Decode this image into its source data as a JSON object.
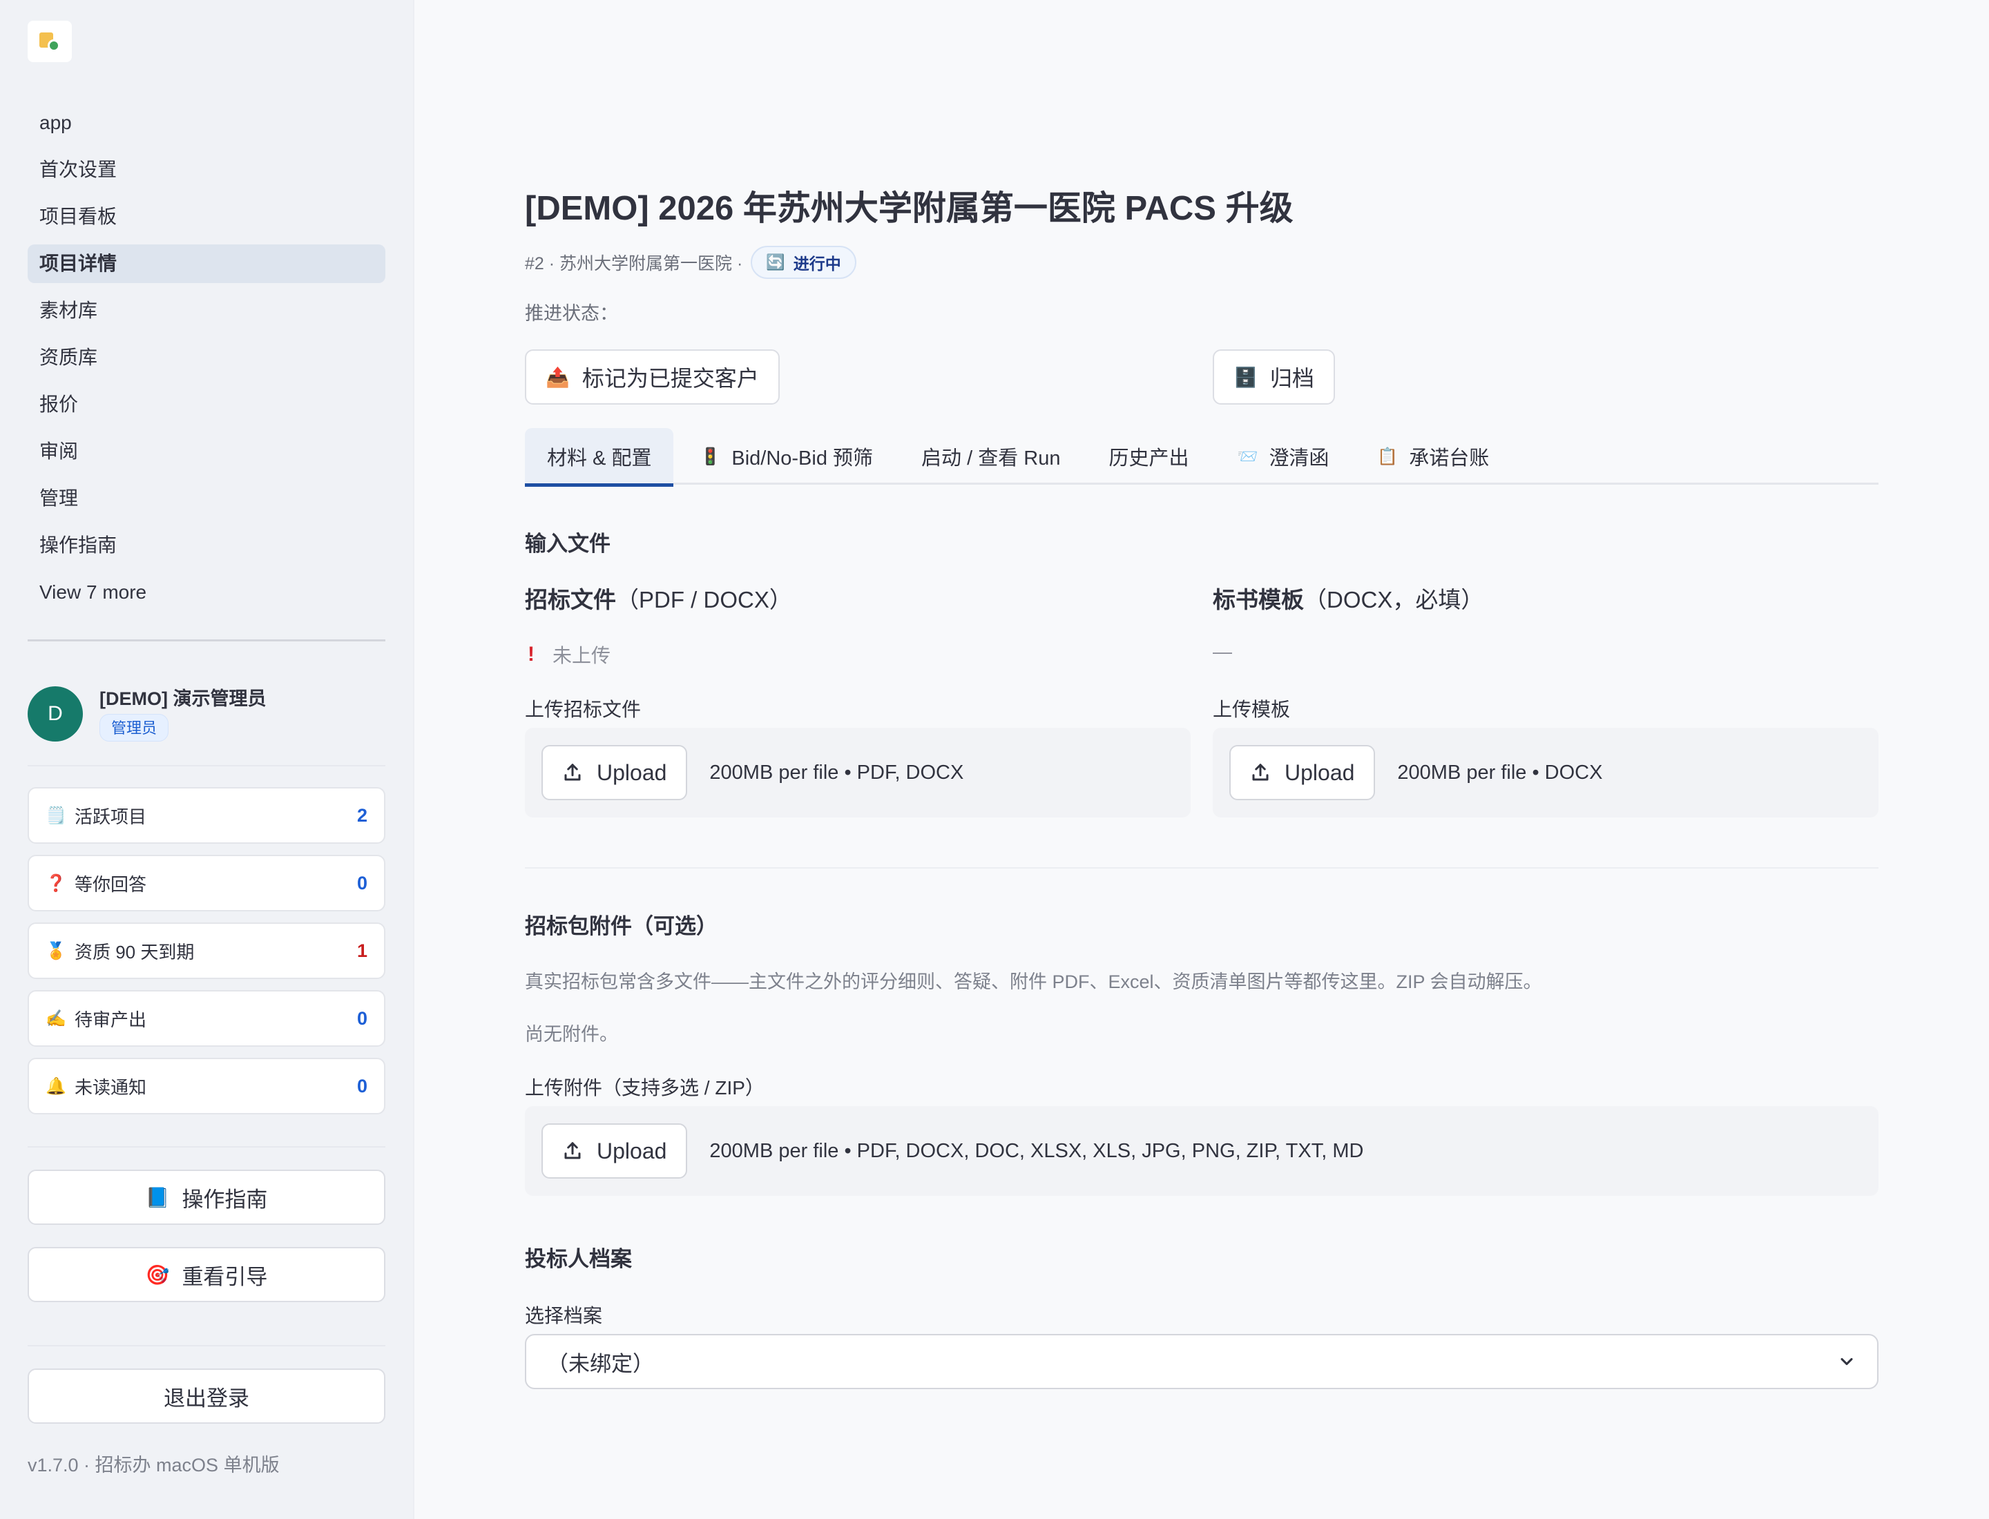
{
  "sidebar": {
    "nav": [
      {
        "label": "app"
      },
      {
        "label": "首次设置"
      },
      {
        "label": "项目看板"
      },
      {
        "label": "项目详情",
        "active": true
      },
      {
        "label": "素材库"
      },
      {
        "label": "资质库"
      },
      {
        "label": "报价"
      },
      {
        "label": "审阅"
      },
      {
        "label": "管理"
      },
      {
        "label": "操作指南"
      }
    ],
    "view_more": "View 7 more",
    "user": {
      "initial": "D",
      "name": "[DEMO] 演示管理员",
      "role": "管理员"
    },
    "stats": [
      {
        "icon": "🗒️",
        "icon_name": "notepad-icon",
        "label": "活跃项目",
        "value": "2",
        "value_color": "#1d5fd6"
      },
      {
        "icon": "❓",
        "icon_name": "question-icon",
        "label": "等你回答",
        "value": "0",
        "value_color": "#1d5fd6"
      },
      {
        "icon": "🏅",
        "icon_name": "medal-icon",
        "label": "资质 90 天到期",
        "value": "1",
        "value_color": "#c81e1e"
      },
      {
        "icon": "✍️",
        "icon_name": "writing-hand-icon",
        "label": "待审产出",
        "value": "0",
        "value_color": "#1d5fd6"
      },
      {
        "icon": "🔔",
        "icon_name": "bell-icon",
        "label": "未读通知",
        "value": "0",
        "value_color": "#1d5fd6"
      }
    ],
    "guide_button": {
      "icon": "📘",
      "label": "操作指南"
    },
    "tour_button": {
      "icon": "🎯",
      "label": "重看引导"
    },
    "logout_button": "退出登录",
    "version": "v1.7.0 · 招标办 macOS 单机版"
  },
  "main": {
    "title": "[DEMO] 2026 年苏州大学附属第一医院 PACS 升级",
    "meta": "#2 · 苏州大学附属第一医院 ·",
    "status": {
      "icon": "🔄",
      "label": "进行中"
    },
    "progress_label": "推进状态：",
    "actions": {
      "mark_submitted": {
        "icon": "📤",
        "label": "标记为已提交客户"
      },
      "archive": {
        "icon": "🗄️",
        "label": "归档"
      }
    },
    "tabs": [
      {
        "icon": "",
        "label": "材料 & 配置",
        "active": true
      },
      {
        "icon": "🚦",
        "label": "Bid/No-Bid 预筛"
      },
      {
        "icon": "",
        "label": "启动 / 查看 Run"
      },
      {
        "icon": "",
        "label": "历史产出"
      },
      {
        "icon": "📨",
        "label": "澄清函"
      },
      {
        "icon": "📋",
        "label": "承诺台账"
      }
    ],
    "input_files": {
      "heading": "输入文件",
      "tender": {
        "title_bold": "招标文件",
        "title_rest": "（PDF / DOCX）",
        "status_icon": "!",
        "status": "未上传",
        "upload_label": "上传招标文件",
        "button": "Upload",
        "hint": "200MB per file • PDF, DOCX"
      },
      "template": {
        "title_bold": "标书模板",
        "title_rest": "（DOCX，必填）",
        "status": "—",
        "upload_label": "上传模板",
        "button": "Upload",
        "hint": "200MB per file • DOCX"
      }
    },
    "attachments": {
      "heading": "招标包附件（可选）",
      "desc": "真实招标包常含多文件——主文件之外的评分细则、答疑、附件 PDF、Excel、资质清单图片等都传这里。ZIP 会自动解压。",
      "empty": "尚无附件。",
      "upload_label": "上传附件（支持多选 / ZIP）",
      "button": "Upload",
      "hint": "200MB per file • PDF, DOCX, DOC, XLSX, XLS, JPG, PNG, ZIP, TXT, MD"
    },
    "bidder": {
      "heading": "投标人档案",
      "select_label": "选择档案",
      "selected": "（未绑定）"
    }
  }
}
